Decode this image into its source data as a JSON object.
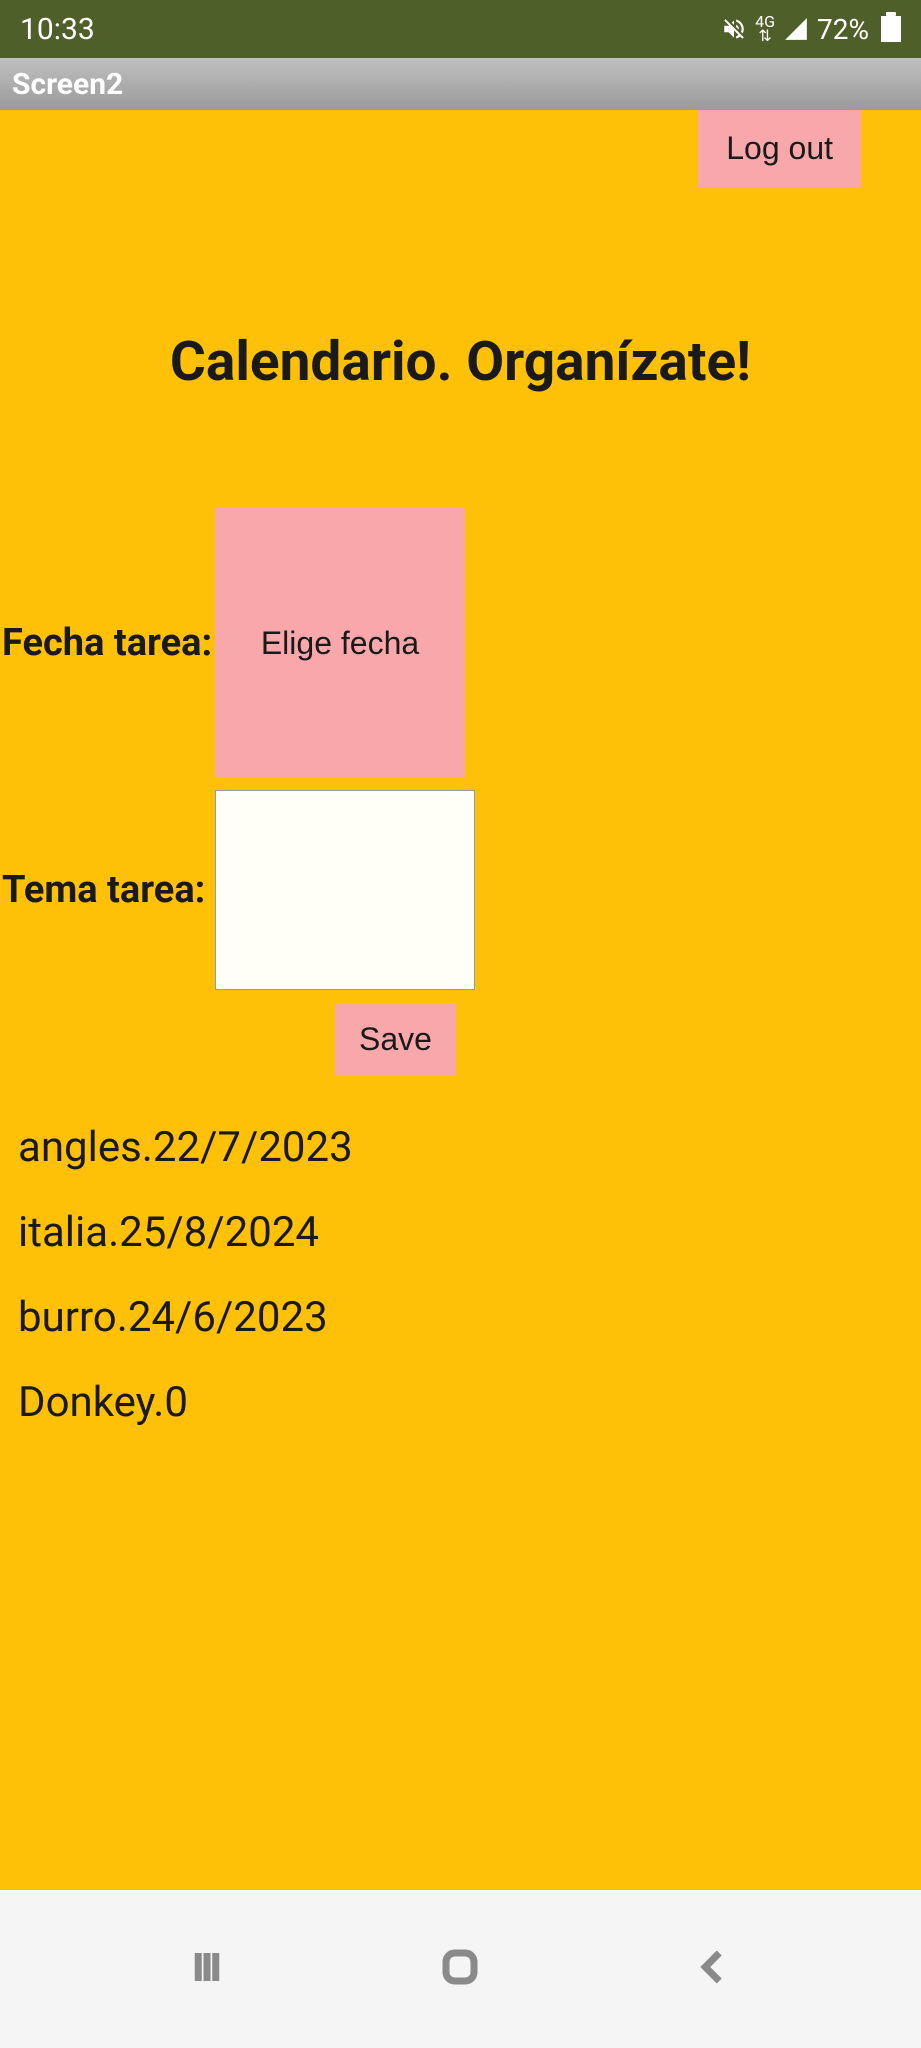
{
  "status": {
    "time": "10:33",
    "battery_pct": "72%",
    "network_label": "4G"
  },
  "appbar": {
    "title": "Screen2"
  },
  "buttons": {
    "logout": "Log out",
    "choose_date": "Elige fecha",
    "save": "Save"
  },
  "labels": {
    "page_title": "Calendario. Organízate!",
    "fecha": "Fecha tarea:",
    "tema": "Tema tarea:"
  },
  "inputs": {
    "tema_value": ""
  },
  "list_items": [
    "angles.22/7/2023",
    "italia.25/8/2024",
    "burro.24/6/2023",
    "Donkey.0"
  ]
}
